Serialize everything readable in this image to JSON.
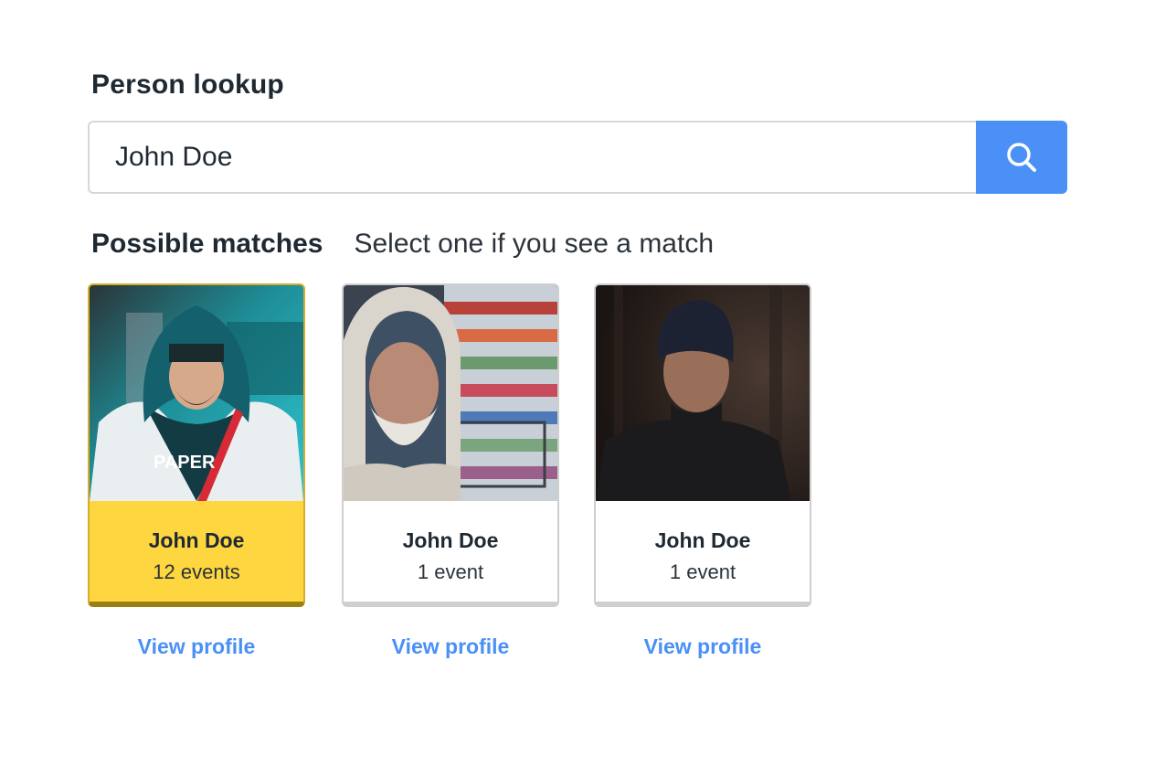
{
  "lookup": {
    "title": "Person lookup",
    "search_value": "John Doe",
    "search_icon": "search-icon"
  },
  "matches": {
    "title": "Possible matches",
    "hint": "Select one if you see a match",
    "cards": [
      {
        "name": "John Doe",
        "events": "12 events",
        "link": "View profile",
        "selected": true,
        "photo": "young man in teal hoodie"
      },
      {
        "name": "John Doe",
        "events": "1 event",
        "link": "View profile",
        "selected": false,
        "photo": "older bearded man in grey hoodie in store aisle"
      },
      {
        "name": "John Doe",
        "events": "1 event",
        "link": "View profile",
        "selected": false,
        "photo": "man in dark beanie in forest"
      }
    ]
  },
  "colors": {
    "accent": "#4a90f7",
    "selected_card": "#fdd640",
    "card_border": "#cfcfcf"
  }
}
